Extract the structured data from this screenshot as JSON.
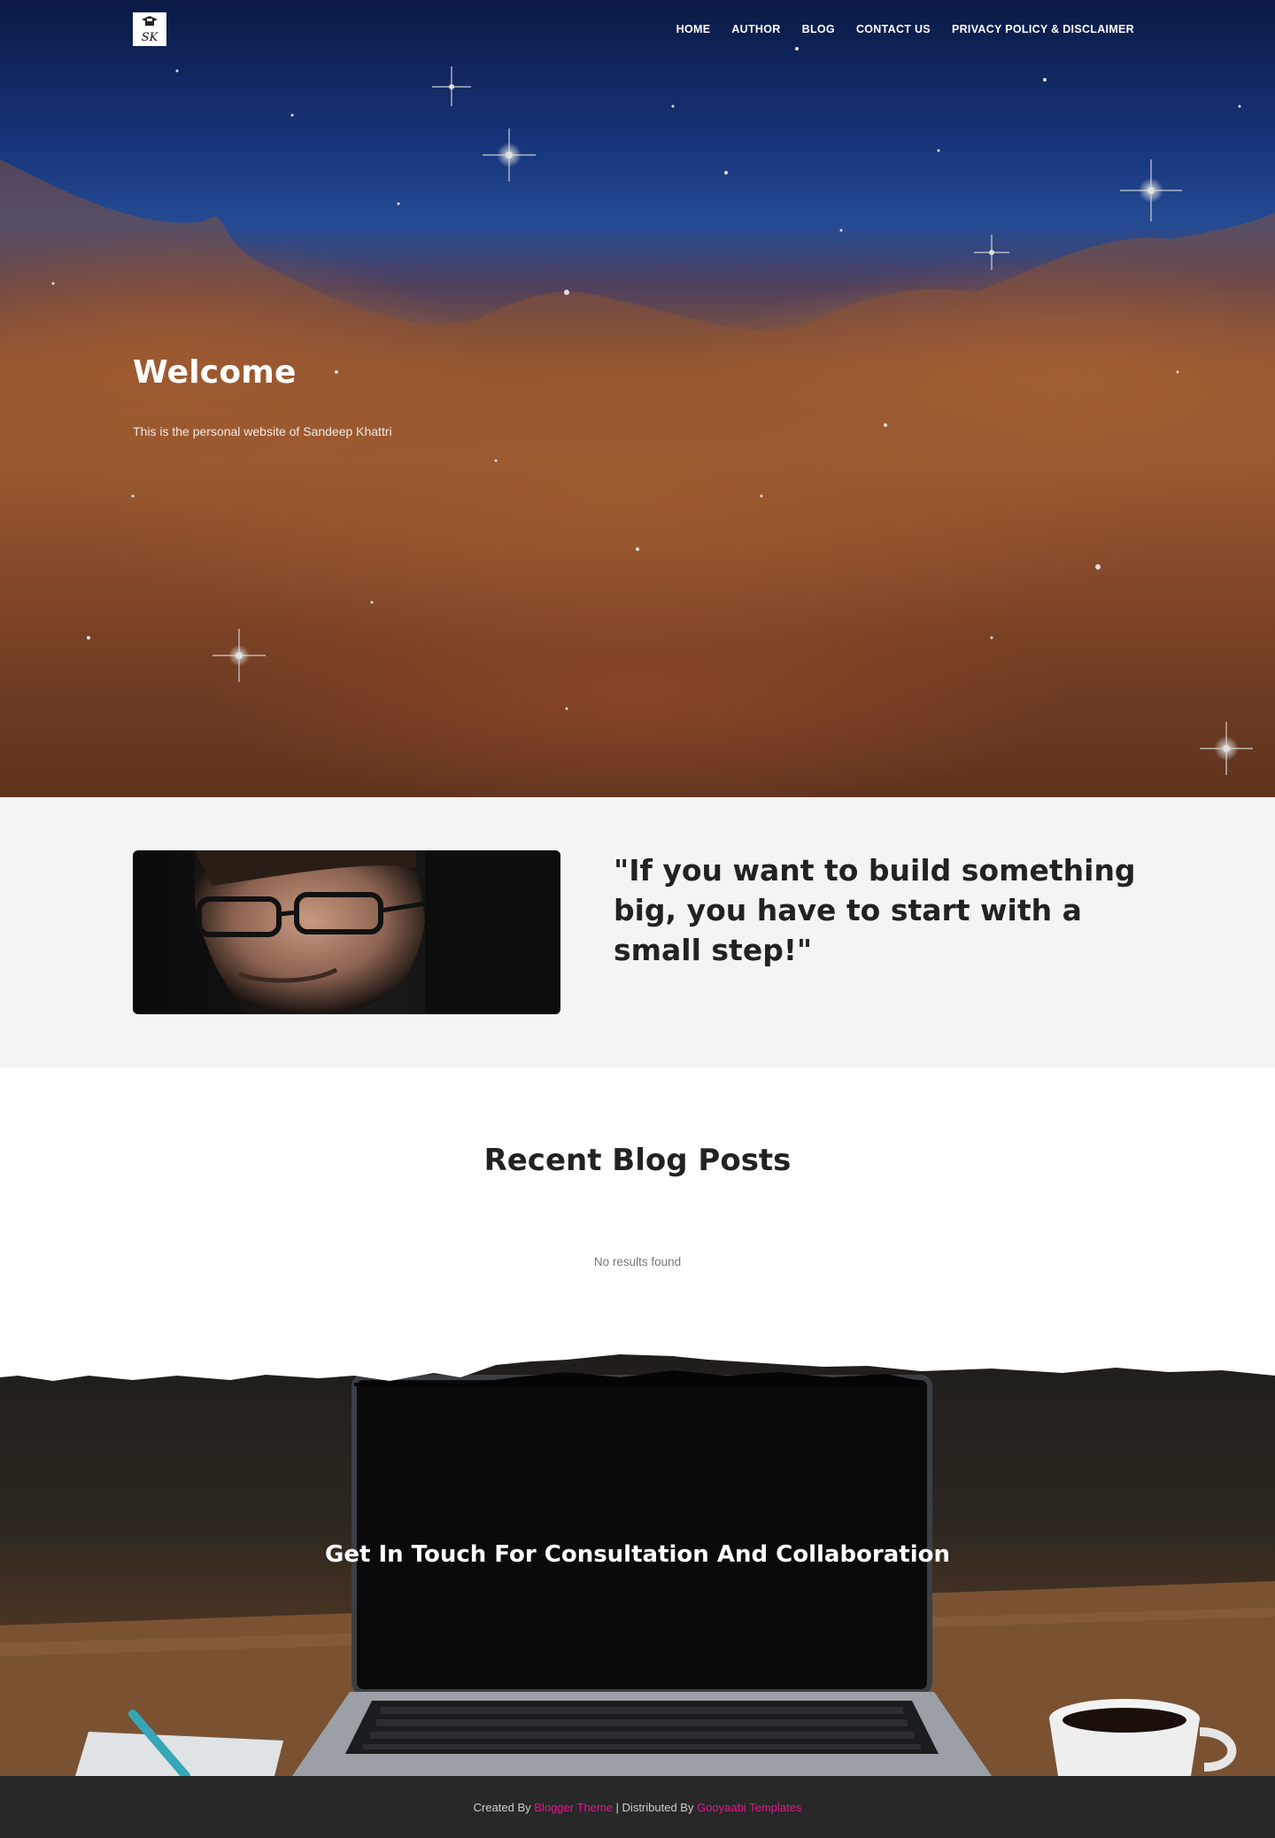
{
  "logo": {
    "text": "SK"
  },
  "nav": {
    "items": [
      {
        "label": "HOME"
      },
      {
        "label": "AUTHOR"
      },
      {
        "label": "BLOG"
      },
      {
        "label": "CONTACT US"
      },
      {
        "label": "PRIVACY POLICY & DISCLAIMER"
      }
    ]
  },
  "hero": {
    "title": "Welcome",
    "subtitle": "This is the personal website of Sandeep Khattri"
  },
  "quote": {
    "text": "\"If you want to build something big, you have to start with a small step!\""
  },
  "blog": {
    "title": "Recent Blog Posts",
    "empty_message": "No results found"
  },
  "cta": {
    "title": "Get In Touch For Consultation And Collaboration"
  },
  "footer": {
    "created_by_prefix": "Created By ",
    "created_by_link": "Blogger Theme",
    "separator": " | Distributed By ",
    "distributed_by_link": "Gooyaabi Templates"
  },
  "colors": {
    "footer_link": "#e0168a",
    "footer_bg": "#282828",
    "quote_bg": "#f4f4f4"
  }
}
